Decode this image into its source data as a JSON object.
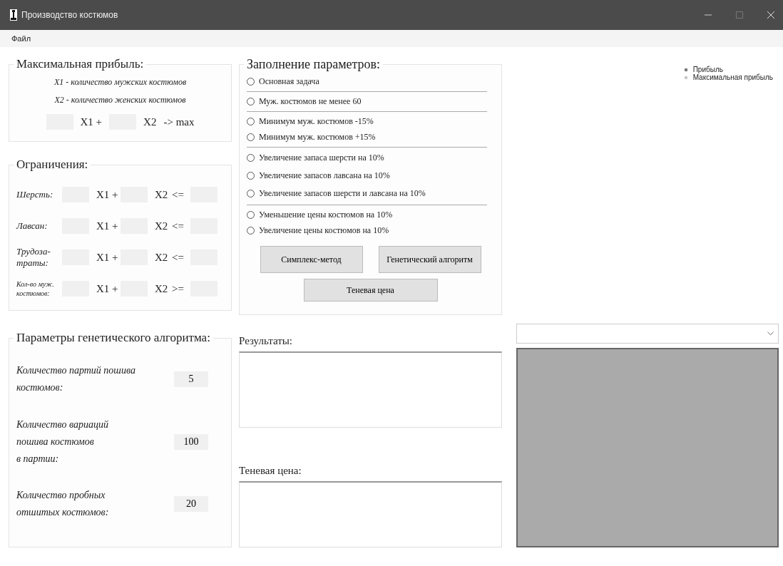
{
  "window": {
    "title": "Производство костюмов"
  },
  "menu": [
    {
      "label": "Файл"
    }
  ],
  "objective": {
    "title": "Максимальная прибыль:",
    "notes": [
      "X1 - количество мужских костюмов",
      "X2 - количество женских костюмов"
    ],
    "x1": "X1 +",
    "x2": "X2",
    "target": "-> max"
  },
  "constraints": {
    "title": "Ограничения:",
    "rows": [
      {
        "label": "Шерсть:",
        "x1": "X1 +",
        "x2": "X2",
        "op": "<="
      },
      {
        "label": "Лавсан:",
        "x1": "X1 +",
        "x2": "X2",
        "op": "<="
      },
      {
        "label": "Трудоза-\nтраты:",
        "x1": "X1 +",
        "x2": "X2",
        "op": "<="
      },
      {
        "label": "Кол-во муж.\nкостюмов:",
        "x1": "X1 +",
        "x2": "X2",
        "op": ">="
      }
    ]
  },
  "genetic": {
    "title": "Параметры генетического алгоритма:",
    "params": [
      {
        "label": "Количество партий пошива\nкостюмов:",
        "value": "5"
      },
      {
        "label": "Количество вариаций\nпошива костюмов\nв партии:",
        "value": "100"
      },
      {
        "label": "Количество пробных\nотшитых костюмов:",
        "value": "20"
      }
    ]
  },
  "parameters": {
    "title": "Заполнение параметров:",
    "groups": [
      [
        {
          "label": "Основная задача",
          "selected": false
        }
      ],
      [
        {
          "label": "Муж. костюмов не менее 60",
          "selected": false
        }
      ],
      [
        {
          "label": "Минимум муж. костюмов -15%",
          "selected": false
        },
        {
          "label": "Минимум муж. костюмов +15%",
          "selected": false
        }
      ],
      [
        {
          "label": "Увеличение запаса шерсти на 10%",
          "selected": false
        },
        {
          "label": "Увеличение запасов лавсана на 10%",
          "selected": false
        },
        {
          "label": "Увеличение запасов шерсти и лавсана на 10%",
          "selected": false
        }
      ],
      [
        {
          "label": "Уменьшение цены костюмов на 10%",
          "selected": false
        },
        {
          "label": "Увеличение цены костюмов на 10%",
          "selected": false
        }
      ]
    ],
    "buttons": [
      "Симплекс-метод",
      "Генетический алгоритм",
      "Теневая цена"
    ]
  },
  "results": {
    "label": "Результаты:"
  },
  "shadow_price": {
    "label": "Теневая цена:"
  },
  "legend": [
    {
      "label": "Прибыль",
      "color": "#7a7a7a"
    },
    {
      "label": "Максимальная прибыль",
      "color": "#c8c8c8"
    }
  ]
}
